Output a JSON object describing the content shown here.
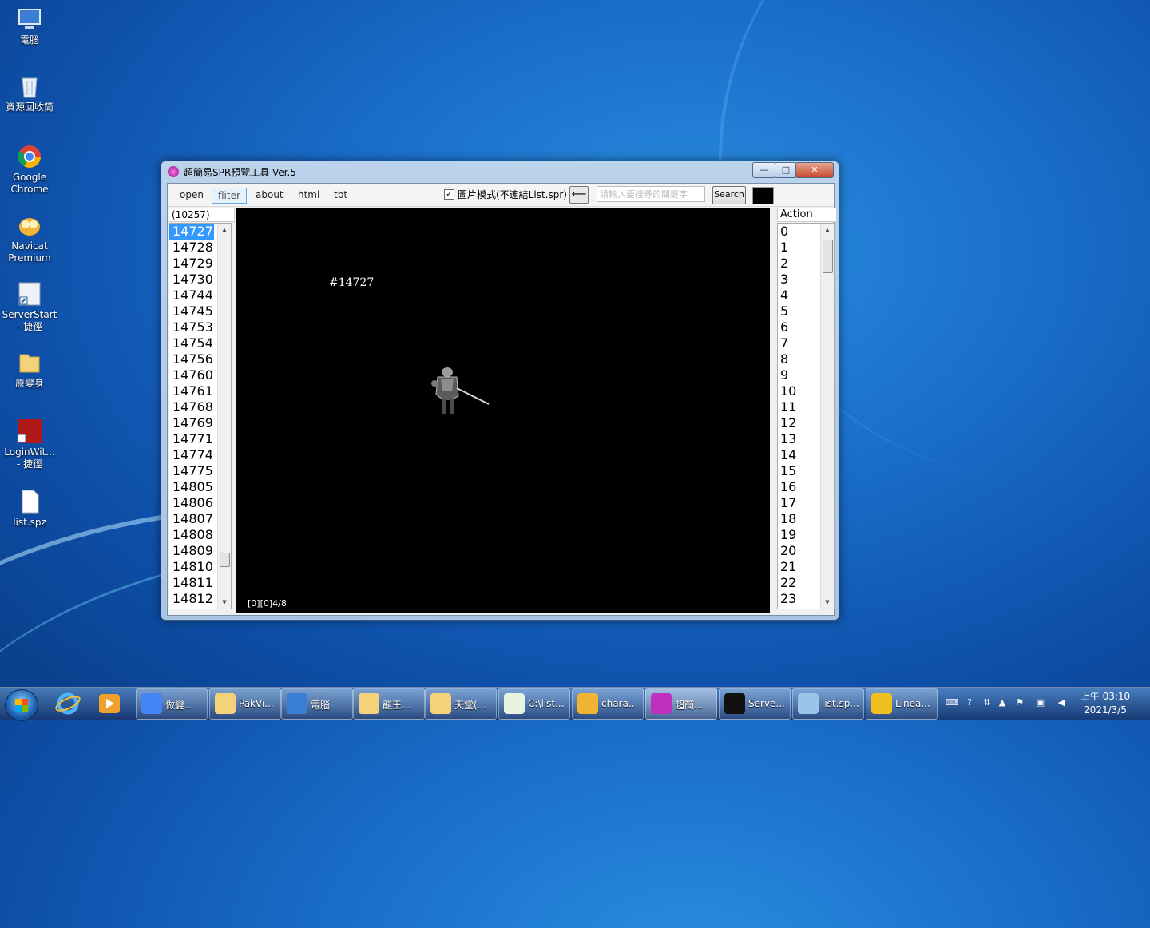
{
  "desktop": {
    "icons": [
      {
        "label": "電腦"
      },
      {
        "label": "資源回收筒"
      },
      {
        "label": "Google Chrome"
      },
      {
        "label": "Navicat Premium"
      },
      {
        "label": "ServerStart - 捷徑"
      },
      {
        "label": "原變身"
      },
      {
        "label": "LoginWit... - 捷徑"
      },
      {
        "label": "list.spz"
      }
    ]
  },
  "window": {
    "title": "超簡易SPR預覽工具 Ver.5",
    "controls": {
      "minimize": "—",
      "maximize": "□",
      "close": "✕"
    },
    "menu": {
      "open": "open",
      "filter": "fliter",
      "about": "about",
      "html": "html",
      "tbt": "tbt"
    },
    "image_mode_label": "圖片模式(不連結List.spr)",
    "image_mode_checked": true,
    "back_arrow": "⟵",
    "search": {
      "placeholder": "請輸入要搜尋的關鍵字",
      "button": "Search"
    },
    "color_swatch": "#000000",
    "sprite_count": "(10257)",
    "sprite_list": [
      "14727",
      "14728",
      "14729",
      "14730",
      "14744",
      "14745",
      "14753",
      "14754",
      "14756",
      "14760",
      "14761",
      "14768",
      "14769",
      "14771",
      "14774",
      "14775",
      "14805",
      "14806",
      "14807",
      "14808",
      "14809",
      "14810",
      "14811",
      "14812"
    ],
    "selected_sprite": "14727",
    "canvas": {
      "sprite_label": "#14727",
      "status": "[0][0]4/8"
    },
    "action_header": "Action",
    "actions": [
      "0",
      "1",
      "2",
      "3",
      "4",
      "5",
      "6",
      "7",
      "8",
      "9",
      "10",
      "11",
      "12",
      "13",
      "14",
      "15",
      "16",
      "17",
      "18",
      "19",
      "20",
      "21",
      "22",
      "23"
    ]
  },
  "taskbar": {
    "items": [
      {
        "label": "做變..."
      },
      {
        "label": "PakVi..."
      },
      {
        "label": "電腦"
      },
      {
        "label": "龍王..."
      },
      {
        "label": "天堂(..."
      },
      {
        "label": "C:\\list..."
      },
      {
        "label": "chara..."
      },
      {
        "label": "超簡..."
      },
      {
        "label": "Serve..."
      },
      {
        "label": "list.sp..."
      },
      {
        "label": "Linea..."
      }
    ],
    "clock": {
      "time": "上午 03:10",
      "date": "2021/3/5"
    }
  }
}
